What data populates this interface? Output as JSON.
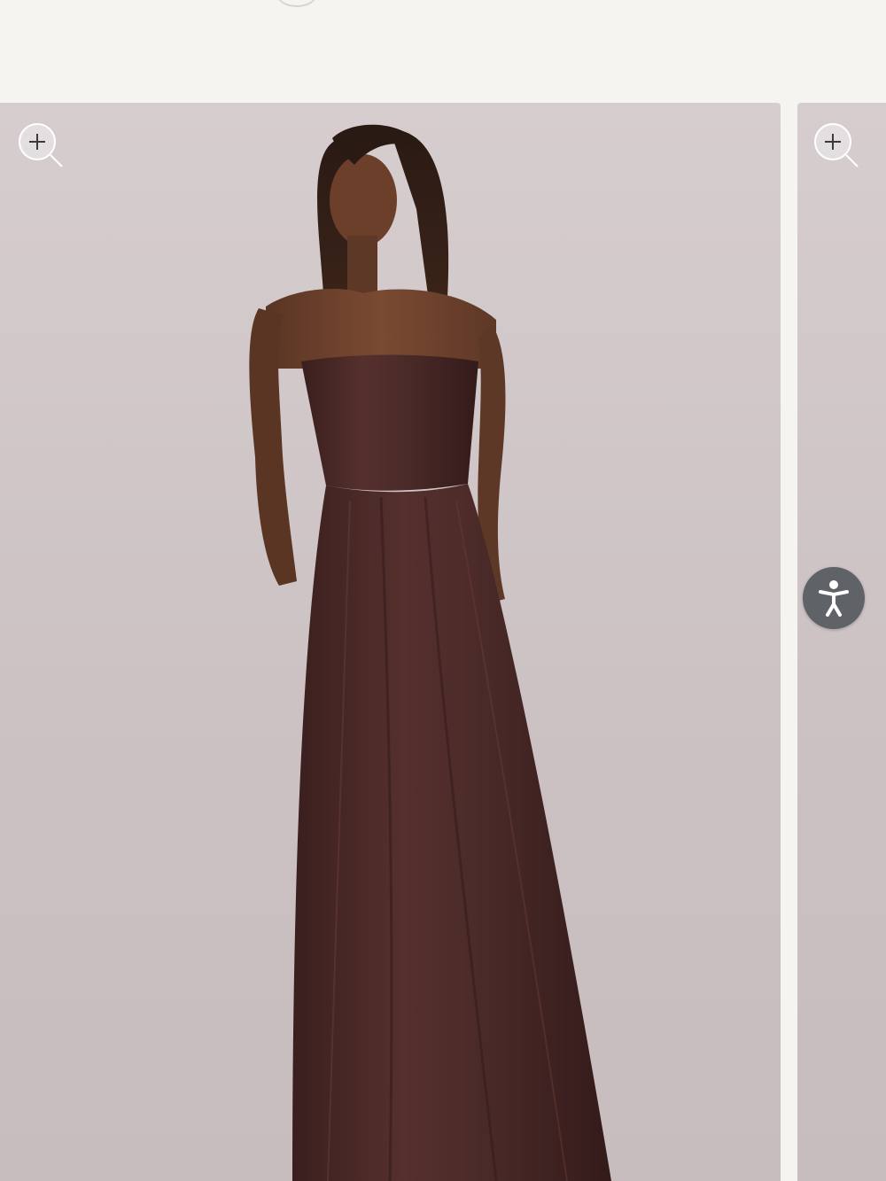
{
  "page": {
    "background_color": "#f6f4f1"
  },
  "gallery": {
    "slides": [
      {
        "image": "model-in-strapless-maxi-dress-photo",
        "dress_color": "#4a2a28",
        "zoom_icon": "zoom-in-icon"
      },
      {
        "image": "next-product-photo-partial",
        "zoom_icon": "zoom-in-icon"
      }
    ],
    "backdrop_color": "#cfc5c7"
  },
  "accessibility_widget": {
    "icon": "accessibility-icon",
    "color": "#5f6368"
  }
}
